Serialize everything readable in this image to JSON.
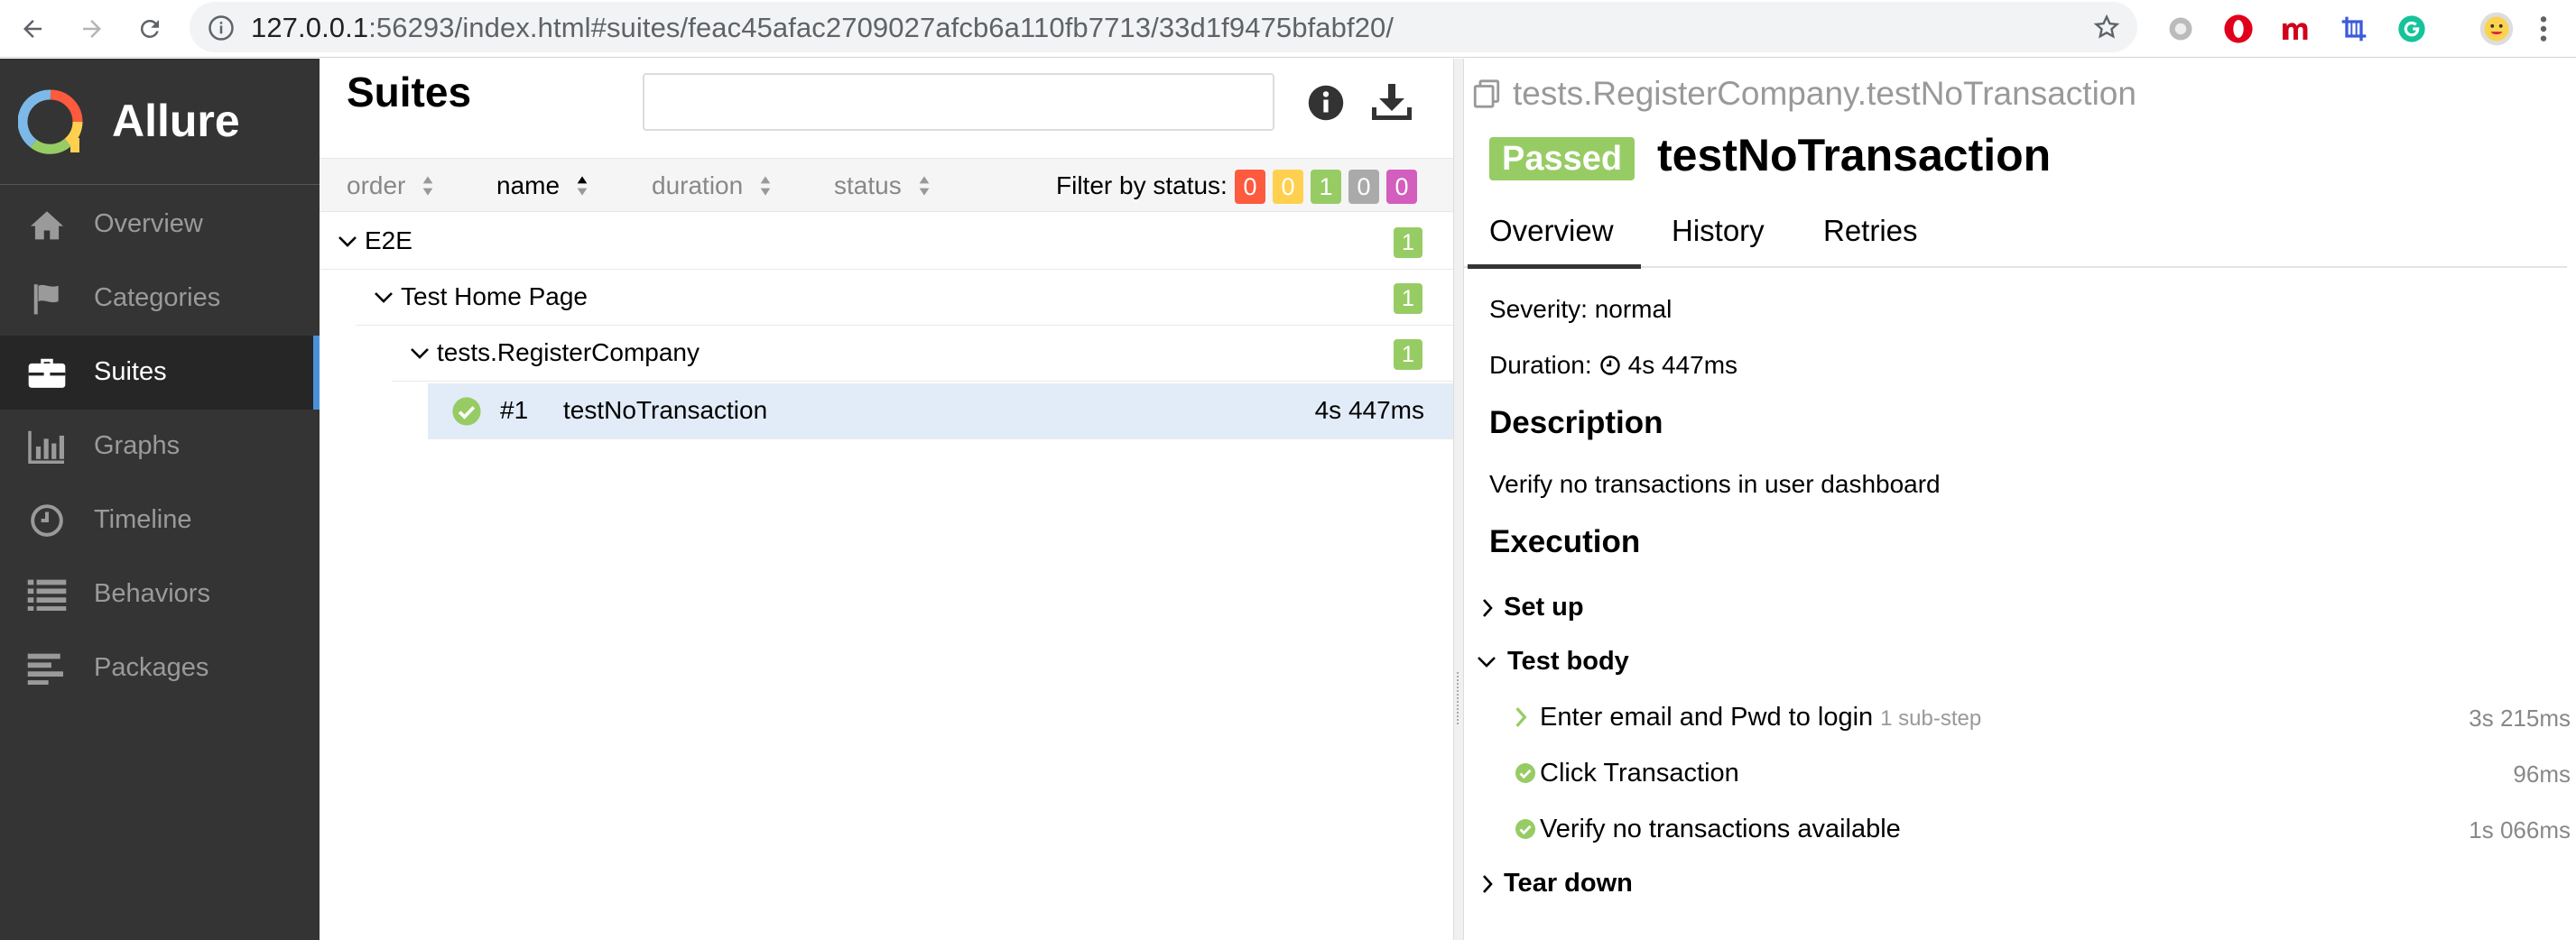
{
  "browser": {
    "url_host": "127.0.0.1",
    "url_rest": ":56293/index.html#suites/feac45afac2709027afcb6a110fb7713/33d1f9475bfabf20/",
    "extensions": [
      "camera-extension-icon",
      "opera-extension-icon",
      "m-extension-icon",
      "crop-extension-icon",
      "grammarly-extension-icon",
      "avatar-icon"
    ]
  },
  "sidebar": {
    "brand": "Allure",
    "items": [
      {
        "label": "Overview",
        "icon": "home-icon"
      },
      {
        "label": "Categories",
        "icon": "flag-icon"
      },
      {
        "label": "Suites",
        "icon": "briefcase-icon",
        "active": true
      },
      {
        "label": "Graphs",
        "icon": "bar-chart-icon"
      },
      {
        "label": "Timeline",
        "icon": "clock-icon"
      },
      {
        "label": "Behaviors",
        "icon": "list-icon"
      },
      {
        "label": "Packages",
        "icon": "align-left-icon"
      }
    ]
  },
  "suites": {
    "title": "Suites",
    "search_value": "",
    "sort": {
      "order": "order",
      "name": "name",
      "duration": "duration",
      "status": "status"
    },
    "filter_label": "Filter by status:",
    "status_counts": [
      {
        "status": "failed",
        "count": "0",
        "color": "#fd5a3e"
      },
      {
        "status": "broken",
        "count": "0",
        "color": "#ffd050"
      },
      {
        "status": "passed",
        "count": "1",
        "color": "#97cc64"
      },
      {
        "status": "skipped",
        "count": "0",
        "color": "#aaaaaa"
      },
      {
        "status": "unknown",
        "count": "0",
        "color": "#d35ebe"
      }
    ],
    "tree": {
      "suite": {
        "label": "E2E",
        "count": "1"
      },
      "sub_suite": {
        "label": "Test Home Page",
        "count": "1"
      },
      "class": {
        "label": "tests.RegisterCompany",
        "count": "1"
      },
      "test": {
        "number": "#1",
        "name": "testNoTransaction",
        "duration": "4s 447ms"
      }
    }
  },
  "result": {
    "breadcrumb": "tests.RegisterCompany.testNoTransaction",
    "status": "Passed",
    "name": "testNoTransaction",
    "tabs": [
      "Overview",
      "History",
      "Retries"
    ],
    "severity": "Severity: normal",
    "duration_label": "Duration:",
    "duration": "4s 447ms",
    "description_heading": "Description",
    "description": "Verify no transactions in user dashboard",
    "execution_heading": "Execution",
    "setup": "Set up",
    "test_body": "Test body",
    "steps": [
      {
        "name": "Enter email and Pwd to login",
        "sub": "1 sub-step",
        "duration": "3s 215ms"
      },
      {
        "name": "Click Transaction",
        "duration": "96ms"
      },
      {
        "name": "Verify no transactions available",
        "duration": "1s 066ms"
      }
    ],
    "teardown": "Tear down"
  },
  "colors": {
    "sidebar": "#343434",
    "passed": "#97cc64",
    "accent": "#4a90d9"
  }
}
